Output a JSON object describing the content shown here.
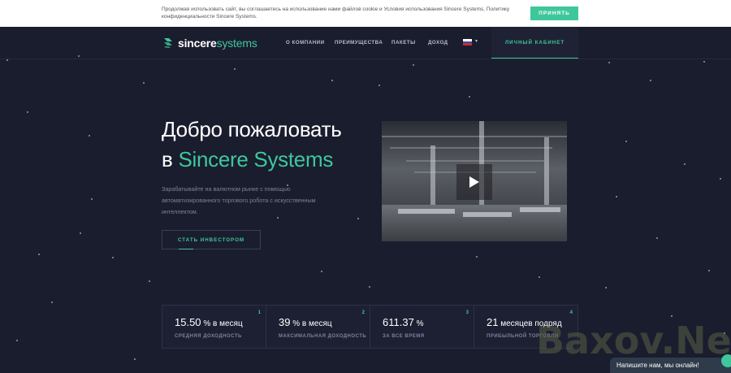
{
  "cookie": {
    "text": "Продолжая использовать сайт, вы соглашаетесь на использование нами файлов cookie и Условия использования Sincere Systems, Политику конфиденциальности Sincere Systems.",
    "accept_label": "ПРИНЯТЬ"
  },
  "header": {
    "logo_bold": "sincere",
    "logo_light": "systems",
    "nav": [
      "О КОМПАНИИ",
      "ПРЕИМУЩЕСТВА",
      "ПАКЕТЫ",
      "ДОХОД"
    ],
    "language_flag": "ru",
    "cabinet_label": "ЛИЧНЫЙ КАБИНЕТ"
  },
  "hero": {
    "title_line1": "Добро пожаловать",
    "title_prefix": "в",
    "title_highlight": "Sincere Systems",
    "description": "Зарабатывайте на валютном рынке с помощью автоматизированного торгового робота с искусственным интеллектом.",
    "cta_label": "СТАТЬ ИНВЕСТОРОМ"
  },
  "video": {
    "play_icon": "play-icon"
  },
  "stats": [
    {
      "num": "1",
      "value": "15.50",
      "unit": " % в месяц",
      "label": "СРЕДНЯЯ ДОХОДНОСТЬ"
    },
    {
      "num": "2",
      "value": "39",
      "unit": " % в месяц",
      "label": "МАКСИМАЛЬНАЯ ДОХОДНОСТЬ"
    },
    {
      "num": "3",
      "value": "611.37",
      "unit": " %",
      "label": "ЗА ВСЕ ВРЕМЯ"
    },
    {
      "num": "4",
      "value": "21",
      "unit": " месяцев подряд",
      "label": "ПРИБЫЛЬНОЙ ТОРГОВЛИ"
    }
  ],
  "watermark": "Baxov.Net",
  "chat_label": "Напишите нам, мы онлайн!",
  "colors": {
    "accent": "#3ec79b",
    "background": "#1a1d2e"
  }
}
